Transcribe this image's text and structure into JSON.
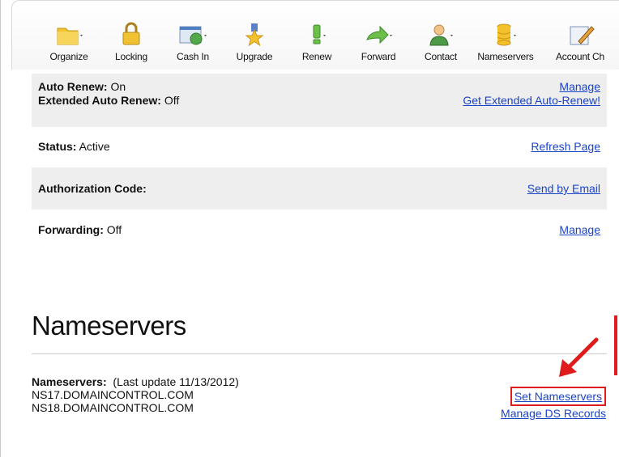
{
  "toolbar": {
    "items": [
      {
        "label": "Organize",
        "icon": "folder-icon"
      },
      {
        "label": "Locking",
        "icon": "lock-icon"
      },
      {
        "label": "Cash In",
        "icon": "cash-in-icon"
      },
      {
        "label": "Upgrade",
        "icon": "upgrade-badge-icon"
      },
      {
        "label": "Renew",
        "icon": "renew-icon"
      },
      {
        "label": "Forward",
        "icon": "forward-arrow-icon"
      },
      {
        "label": "Contact",
        "icon": "contact-person-icon"
      },
      {
        "label": "Nameservers",
        "icon": "database-icon"
      },
      {
        "label": "Account Ch",
        "icon": "edit-icon"
      }
    ]
  },
  "settings": {
    "auto_renew": {
      "label": "Auto Renew:",
      "value": "On",
      "action": "Manage"
    },
    "extended_auto_renew": {
      "label": "Extended Auto Renew:",
      "value": "Off",
      "action": "Get Extended Auto-Renew!"
    },
    "status": {
      "label": "Status:",
      "value": "Active",
      "action": "Refresh Page"
    },
    "auth_code": {
      "label": "Authorization Code:",
      "action": "Send by Email"
    },
    "forwarding": {
      "label": "Forwarding:",
      "value": "Off",
      "action": "Manage"
    }
  },
  "nameservers": {
    "title": "Nameservers",
    "label": "Nameservers:",
    "last_update": "(Last update 11/13/2012)",
    "servers": [
      "NS17.DOMAINCONTROL.COM",
      "NS18.DOMAINCONTROL.COM"
    ],
    "set_action": "Set Nameservers",
    "ds_action": "Manage DS Records"
  },
  "colors": {
    "link": "#1a44c8",
    "highlight": "#e01b1b",
    "row_shade": "#eeeeee"
  }
}
